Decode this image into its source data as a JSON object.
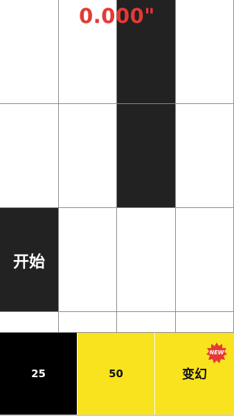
{
  "timer": {
    "value": "0.000\""
  },
  "start_tile": {
    "label": "开始"
  },
  "modes": [
    {
      "label": "25"
    },
    {
      "label": "50"
    },
    {
      "label": "变幻",
      "badge": "NEW"
    }
  ],
  "colors": {
    "tile_black": "#222222",
    "tile_white": "#ffffff",
    "grid_line": "#8a8a8a",
    "timer_red": "#e53935",
    "mode_yellow": "#f9e21e",
    "badge_red": "#e53935"
  }
}
